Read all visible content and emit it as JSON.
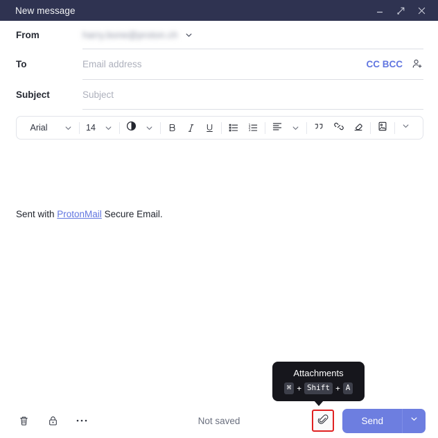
{
  "window": {
    "title": "New message",
    "controls": [
      {
        "name": "minimize-button",
        "icon": "minimize-icon"
      },
      {
        "name": "maximize-button",
        "icon": "expand-icon"
      },
      {
        "name": "close-button",
        "icon": "close-icon"
      }
    ]
  },
  "fields": {
    "from": {
      "label": "From",
      "address": "harry.bone@proton.ch",
      "dropdown_icon": "chevron-down-icon"
    },
    "to": {
      "label": "To",
      "placeholder": "Email address",
      "value": "",
      "cc_bcc": "CC BCC",
      "contacts_icon": "add-contact-icon"
    },
    "subject": {
      "label": "Subject",
      "placeholder": "Subject",
      "value": ""
    }
  },
  "toolbar": {
    "font_family": "Arial",
    "font_size": "14",
    "items": [
      {
        "name": "font-color-button",
        "icon": "half-circle-icon"
      },
      {
        "name": "bold-button",
        "icon": "bold-icon",
        "label": "B"
      },
      {
        "name": "italic-button",
        "icon": "italic-icon",
        "label": "I"
      },
      {
        "name": "underline-button",
        "icon": "underline-icon",
        "label": "U"
      },
      {
        "name": "bulleted-list-button",
        "icon": "bulleted-list-icon"
      },
      {
        "name": "numbered-list-button",
        "icon": "numbered-list-icon"
      },
      {
        "name": "align-button",
        "icon": "align-left-icon"
      },
      {
        "name": "blockquote-button",
        "icon": "quote-icon"
      },
      {
        "name": "link-button",
        "icon": "link-icon"
      },
      {
        "name": "clear-formatting-button",
        "icon": "eraser-icon"
      },
      {
        "name": "insert-image-button",
        "icon": "image-icon"
      },
      {
        "name": "more-options-button",
        "icon": "chevron-down-icon"
      }
    ]
  },
  "body": {
    "signature_prefix": "Sent with ",
    "signature_link": "ProtonMail",
    "signature_suffix": " Secure Email."
  },
  "tooltip": {
    "title": "Attachments",
    "keys": [
      "⌘",
      "Shift",
      "A"
    ],
    "separator": "+"
  },
  "footer": {
    "delete_icon": "trash-icon",
    "encryption_icon": "lock-icon",
    "more_icon": "ellipsis-icon",
    "status": "Not saved",
    "attachment_icon": "paperclip-icon",
    "send_label": "Send",
    "send_caret_icon": "chevron-down-icon"
  },
  "colors": {
    "titlebar": "#2f3351",
    "accent_blue": "#6176e0",
    "send_button": "#6d7ee0",
    "highlight_red": "#e02121",
    "tooltip_bg": "#16161c"
  }
}
